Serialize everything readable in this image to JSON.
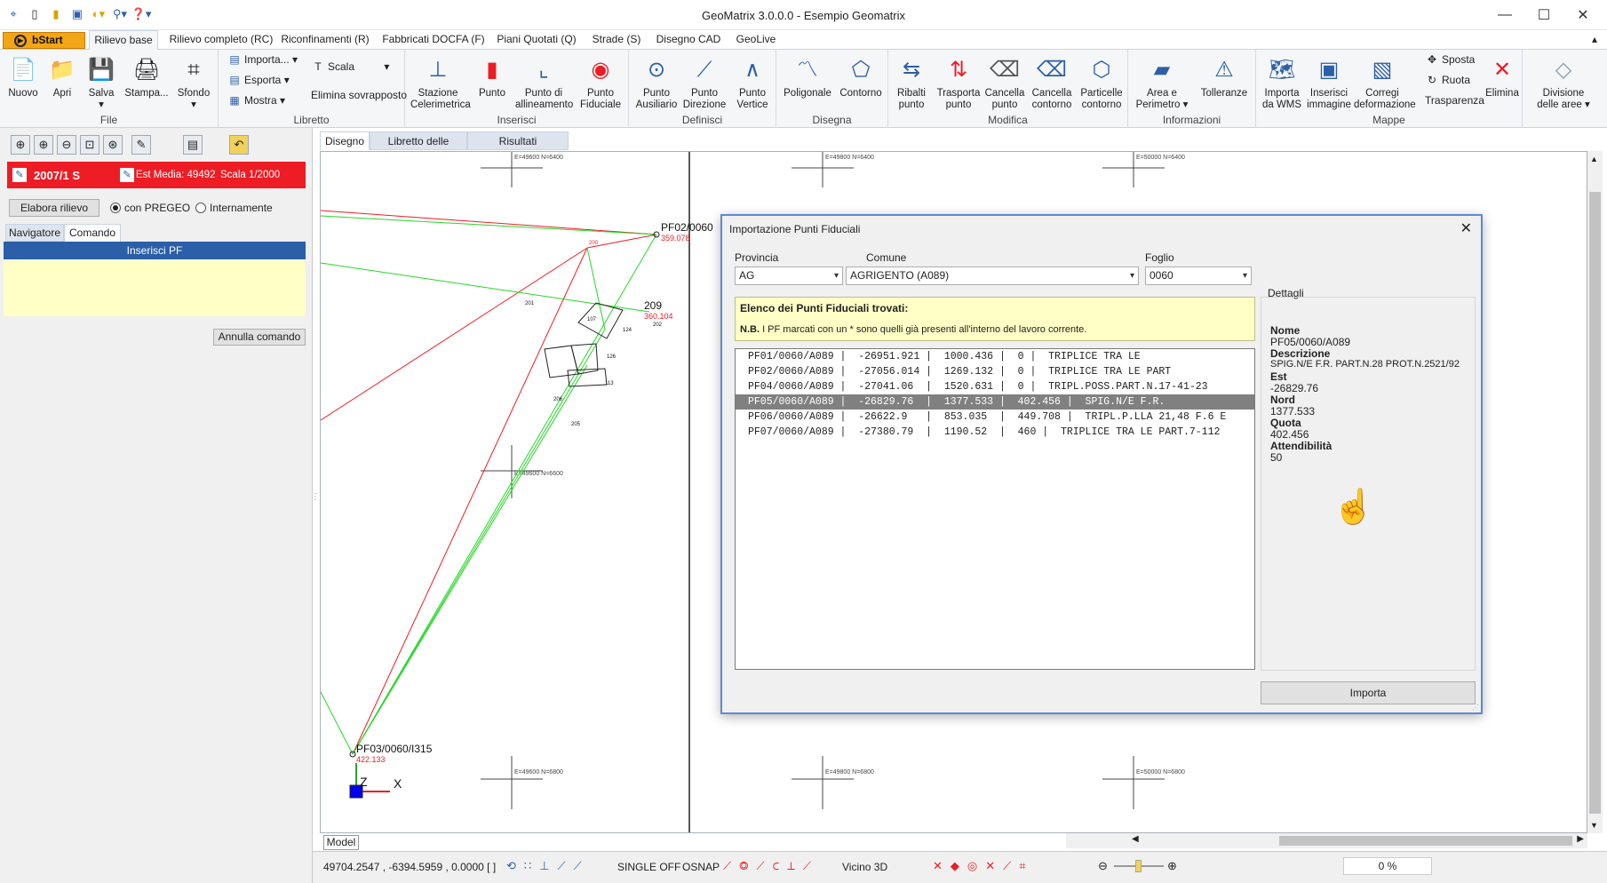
{
  "window": {
    "title": "GeoMatrix 3.0.0.0 - Esempio Geomatrix"
  },
  "qat": [
    "app-icon",
    "new-doc-icon",
    "open-icon",
    "save-icon",
    "palette-icon",
    "tools-icon",
    "help-icon"
  ],
  "ribbon_tabs": [
    "bStart",
    "Rilievo base",
    "Rilievo completo (RC)",
    "Riconfinamenti (R)",
    "Fabbricati DOCFA (F)",
    "Piani Quotati (Q)",
    "Strade (S)",
    "Disegno CAD",
    "GeoLive"
  ],
  "groups": {
    "file": {
      "label": "File",
      "buttons": [
        "Nuovo",
        "Apri",
        "Salva",
        "Stampa...",
        "Sfondo"
      ]
    },
    "libretto": {
      "label": "Libretto",
      "items": [
        "Importa...",
        "Esporta",
        "Mostra",
        "Scala",
        "Elimina sovrapposto"
      ]
    },
    "inserisci": {
      "label": "Inserisci",
      "buttons": [
        "Stazione Celerimetrica",
        "Punto",
        "Punto di allineamento",
        "Punto Fiduciale"
      ]
    },
    "definisci": {
      "label": "Definisci",
      "buttons": [
        "Punto Ausiliario",
        "Punto Direzione",
        "Punto Vertice"
      ]
    },
    "disegna": {
      "label": "Disegna",
      "buttons": [
        "Poligonale",
        "Contorno"
      ]
    },
    "modifica": {
      "label": "Modifica",
      "buttons": [
        "Ribalti punto",
        "Trasporta punto",
        "Cancella punto",
        "Cancella contorno",
        "Particelle contorno"
      ]
    },
    "informazioni": {
      "label": "Informazioni",
      "buttons": [
        "Area e Perimetro",
        "Tolleranze"
      ]
    },
    "mappe": {
      "label": "Mappe",
      "buttons": [
        "Importa da WMS",
        "Inserisci immagine",
        "Corregi deformazione"
      ],
      "items": [
        "Sposta",
        "Ruota",
        "Trasparenza"
      ],
      "elimina": "Elimina"
    },
    "divisione": {
      "label": "Divisione delle aree"
    }
  },
  "left": {
    "rilievo": "2007/1 S",
    "est_media": "Est Media: 49492",
    "scala": "Scala 1/2000",
    "elabora": "Elabora rilievo",
    "radio1": "con PREGEO",
    "radio2": "Internamente",
    "tabs": [
      "Navigatore",
      "Comando"
    ],
    "command_title": "Inserisci PF",
    "annulla": "Annulla comando"
  },
  "drawing_tabs": [
    "Disegno",
    "Libretto delle misure",
    "Risultati Elaborazione"
  ],
  "canvas": {
    "labels": {
      "pf02": "PF02/0060",
      "pf02_val": "359.078",
      "pf03": "PF03/0060/I315",
      "pf03_val": "422.133",
      "p209": "209",
      "p209_val": "360.104",
      "p200": "200",
      "p201": "201",
      "p202": "202",
      "p124": "124",
      "p107": "107",
      "p113": "113",
      "p206": "206",
      "p205": "205",
      "p126": "126"
    },
    "grid": [
      "E=49600 N=6400",
      "E=49800 N=6400",
      "E=50000 N=6400",
      "E=49600 N=6600",
      "E=49600 N=6800",
      "E=49800 N=6800",
      "E=50000 N=6800"
    ],
    "axis_z": "Z",
    "axis_x": "X"
  },
  "model_tab": "Model",
  "status": {
    "coords": "49704.2547 , -6394.5959 , 0.0000 [ ]",
    "single": "SINGLE OFF",
    "osnap": "OSNAP",
    "vicino": "Vicino 3D",
    "zoom": "0 %"
  },
  "dialog": {
    "title": "Importazione Punti Fiduciali",
    "provincia_label": "Provincia",
    "provincia": "AG",
    "comune_label": "Comune",
    "comune": "AGRIGENTO (A089)",
    "foglio_label": "Foglio",
    "foglio": "0060",
    "elenco": "Elenco dei Punti Fiduciali trovati:",
    "nb": "N.B.",
    "nota": "I PF marcati con un * sono quelli già presenti all'interno del lavoro corrente.",
    "rows": [
      "PF01/0060/A089 |  -26951.921 |  1000.436 |  0 |  TRIPLICE TRA LE",
      "PF02/0060/A089 |  -27056.014 |  1269.132 |  0 |  TRIPLICE TRA LE PART",
      "PF04/0060/A089 |  -27041.06  |  1520.631 |  0 |  TRIPL.POSS.PART.N.17-41-23",
      "PF05/0060/A089 |  -26829.76  |  1377.533 |  402.456 |  SPIG.N/E F.R.",
      "PF06/0060/A089 |  -26622.9   |  853.035  |  449.708 |  TRIPL.P.LLA 21,48 F.6 E",
      "PF07/0060/A089 |  -27380.79  |  1190.52  |  460 |  TRIPLICE TRA LE PART.7-112"
    ],
    "selected": 3,
    "dettagli": "Dettagli",
    "nome_l": "Nome",
    "nome": "PF05/0060/A089",
    "descr_l": "Descrizione",
    "descr": "SPIG.N/E F.R. PART.N.28 PROT.N.2521/92",
    "est_l": "Est",
    "est": "-26829.76",
    "nord_l": "Nord",
    "nord": "1377.533",
    "quota_l": "Quota",
    "quota": "402.456",
    "att_l": "Attendibilità",
    "att": "50",
    "importa": "Importa"
  },
  "colors": {
    "accent": "#2b5fa8",
    "red": "#ee1c24",
    "bstart": "#f2a515"
  }
}
